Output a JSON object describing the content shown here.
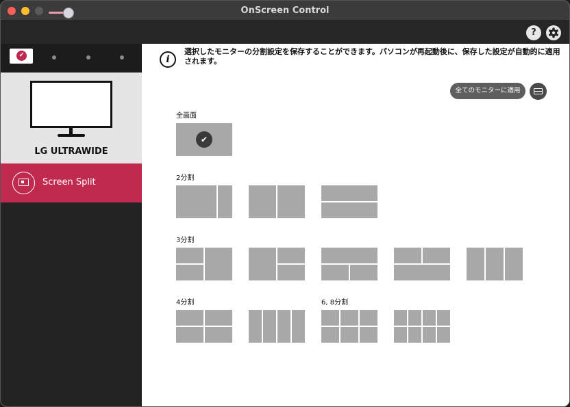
{
  "window": {
    "title": "OnScreen Control"
  },
  "toolbar": {
    "help_label": "?",
    "settings_icon": "gear-icon"
  },
  "sidebar": {
    "monitor_name": "LG ULTRAWIDE",
    "nav_item_label": "Screen Split"
  },
  "content": {
    "info_text": "選択したモニターの分割設定を保存することができます。パソコンが再起動後に、保存した設定が自動的に適用されます。",
    "apply_all_label": "全てのモニターに適用",
    "sections": {
      "full": "全画面",
      "split2": "2分割",
      "split3": "3分割",
      "split4": "4分割",
      "split68": "6, 8分割"
    }
  },
  "colors": {
    "accent": "#c12a4f",
    "cell": "#a8a8a8",
    "sidebar": "#232323"
  }
}
